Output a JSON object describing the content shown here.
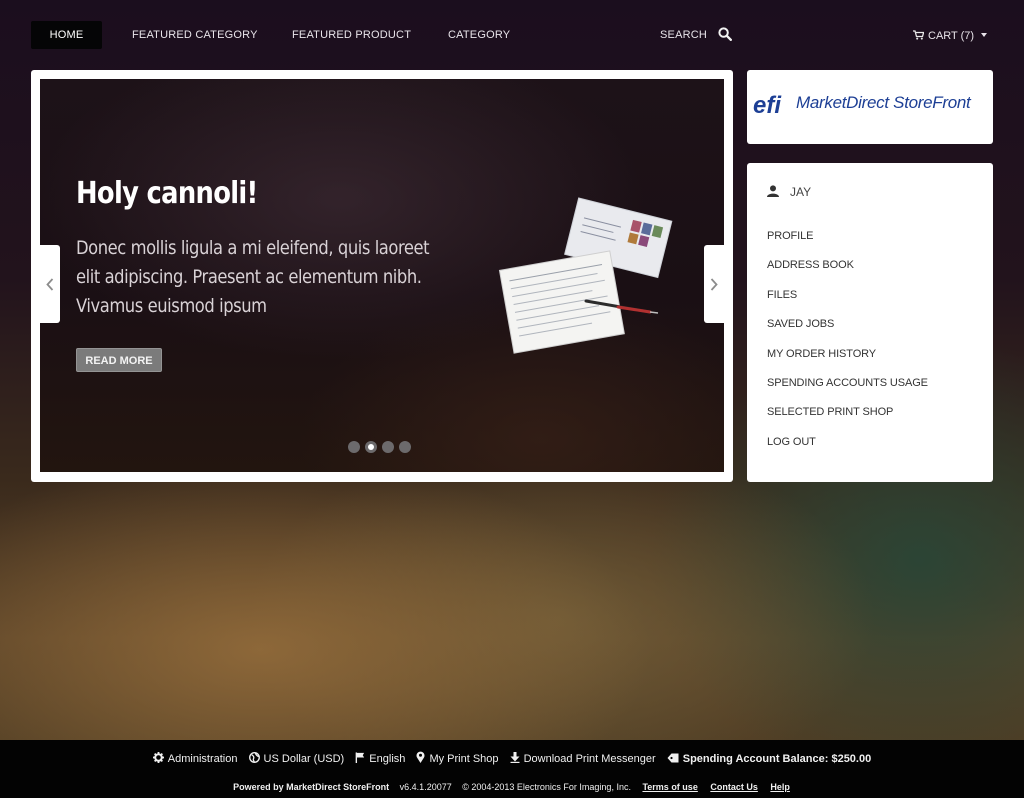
{
  "nav": {
    "home": "HOME",
    "featured_category": "FEATURED CATEGORY",
    "featured_product": "FEATURED PRODUCT",
    "category": "CATEGORY",
    "search": "SEARCH",
    "cart": "CART (7)"
  },
  "slider": {
    "title": "Holy cannoli!",
    "text": "Donec mollis ligula a mi eleifend, quis laoreet elit adipiscing. Praesent ac elementum nibh. Vivamus euismod ipsum",
    "button": "READ MORE",
    "dots": 4,
    "active_dot": 2
  },
  "brand": {
    "logo_mark": "efi",
    "logo_text": "MarketDirect StoreFront",
    "color": "#1d3f95"
  },
  "account": {
    "user": "JAY",
    "menu": [
      "PROFILE",
      "ADDRESS BOOK",
      "FILES",
      "SAVED JOBS",
      "MY ORDER HISTORY",
      "SPENDING ACCOUNTS USAGE",
      "SELECTED PRINT SHOP",
      "LOG OUT"
    ]
  },
  "footer": {
    "administration": "Administration",
    "currency": "US Dollar (USD)",
    "language": "English",
    "print_shop": "My Print Shop",
    "download": "Download Print Messenger",
    "balance": "Spending Account Balance: $250.00",
    "powered_by": "Powered by MarketDirect StoreFront",
    "version": "v6.4.1.20077",
    "copyright": "© 2004-2013 Electronics For Imaging, Inc.",
    "terms": "Terms of use",
    "contact": "Contact Us",
    "help": "Help"
  }
}
